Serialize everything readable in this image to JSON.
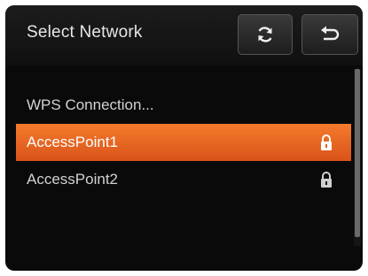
{
  "header": {
    "title": "Select Network",
    "refresh_icon": "refresh-icon",
    "back_icon": "return-icon"
  },
  "networks": [
    {
      "label": "WPS Connection...",
      "locked": false,
      "selected": false
    },
    {
      "label": "AccessPoint1",
      "locked": true,
      "selected": true
    },
    {
      "label": "AccessPoint2",
      "locked": true,
      "selected": false
    }
  ],
  "colors": {
    "selection": "#f06a22",
    "background": "#0a0a0a",
    "text": "#d2d2d2"
  }
}
